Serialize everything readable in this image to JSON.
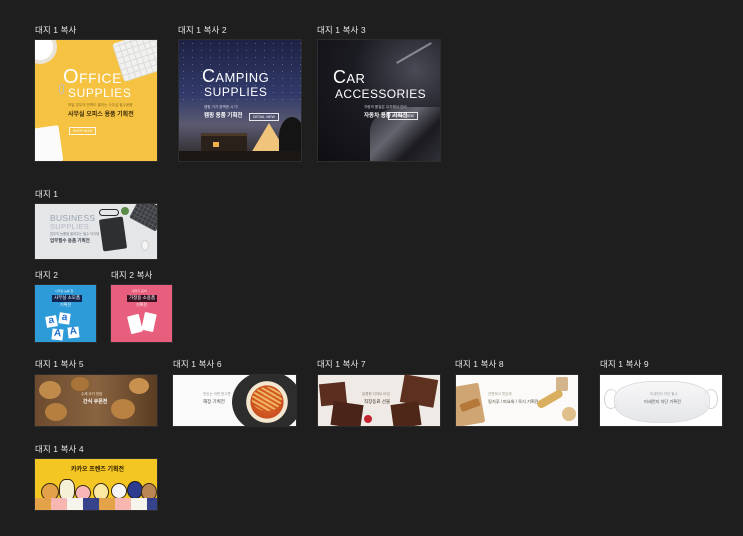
{
  "colors": {
    "background": "#1e1e1e",
    "office_yellow": "#f5c242",
    "camping_navy": "#24284a",
    "car_dark": "#141418",
    "business_gray": "#e4e6e8",
    "blue_banner": "#2d9bd8",
    "pink_banner": "#e85f7e",
    "kakao_yellow": "#f3c623"
  },
  "artboards": [
    {
      "label": "대지 1 복사",
      "title_big": "O",
      "title_rest": "FFICE",
      "title_line2": "SUPPLIES",
      "sub_small": "하일 업무의 만족도 올리는 사무실 필수용품",
      "headline": "사무실 오피스 용품 기획전",
      "button": "SHOP NOW"
    },
    {
      "label": "대지 1 복사 2",
      "title_big": "C",
      "title_rest": "AMPING",
      "title_line2": "SUPPLIES",
      "sub_small": "캠핑 가기 완벽한 시기!",
      "headline": "캠핑 용품 기획전",
      "button": "DETAIL VIEW"
    },
    {
      "label": "대지 1 복사 3",
      "title_big": "C",
      "title_rest": "AR",
      "title_line2": "ACCESSORIES",
      "sub_small": "차량의 품질은 유지해서 관리",
      "headline": "자동차 용품 기획전",
      "button": "DETAIL VIEW"
    },
    {
      "label": "대지 1",
      "title_line1": "BUSINESS",
      "title_line2": "SUPPLIES",
      "sub_small": "업무의 능률을 올려주는 필수 아이템",
      "headline": "업무필수 용품 기획전"
    },
    {
      "label": "대지 2",
      "sub_small": "사무실 능률 업",
      "headline_box": "사무실 소모품",
      "headline2": "기획전",
      "letters": [
        "a",
        "a",
        "A",
        "A"
      ]
    },
    {
      "label": "대지 2 복사",
      "sub_small": "새학기 준비",
      "headline_box": "가정용 소용품",
      "headline2": "기획전"
    },
    {
      "label": "대지 1 복사 5",
      "sub_small": "수제 쿠키 맛집",
      "headline": "간식 쿠폰전"
    },
    {
      "label": "대지 1 복사 6",
      "sub_small": "맛있는 라면 한그릇",
      "headline": "해장 기획전"
    },
    {
      "label": "대지 1 복사 7",
      "sub_small": "달콤한 디저트 타임",
      "headline": "직장동료 선물"
    },
    {
      "label": "대지 1 복사 8",
      "sub_small": "간편하고 맛있게",
      "headline": "핑거푸 / 마요와 / 육식 기획전"
    },
    {
      "label": "대지 1 복사 9",
      "sub_small": "미세먼지 차단 필수",
      "headline": "미세먼지 차단 기획전"
    },
    {
      "label": "대지 1 복사 4",
      "headline": "카카오 프렌즈 기획전"
    }
  ]
}
